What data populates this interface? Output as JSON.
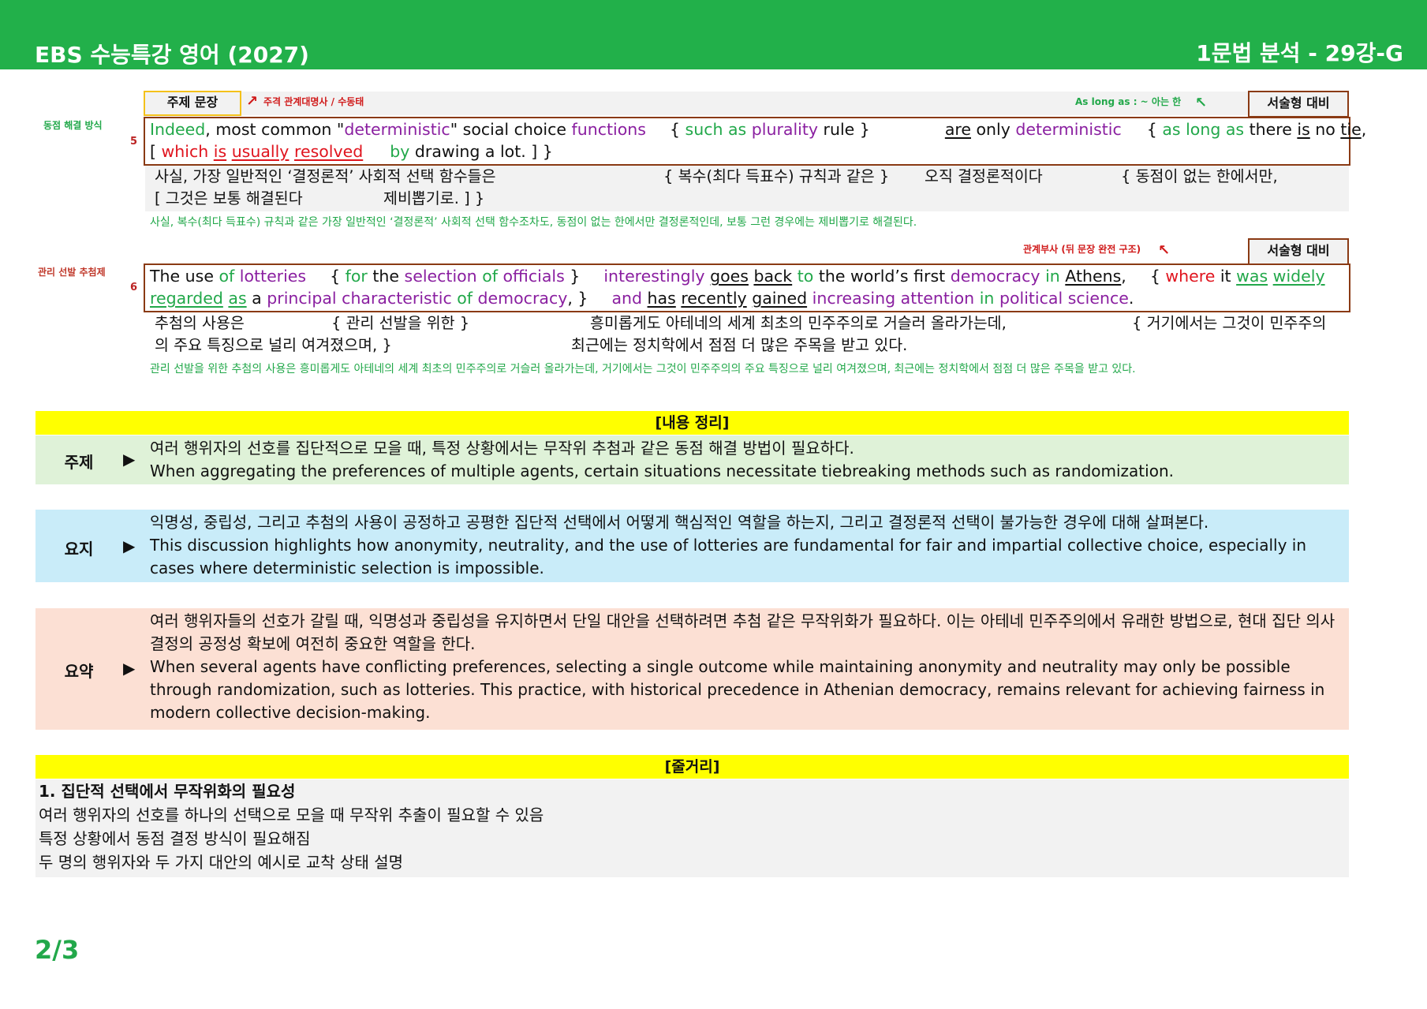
{
  "header": {
    "title_left": "EBS 수능특강 영어 (2027)",
    "title_right": "1문법 분석 - 29강-G"
  },
  "tags": {
    "topic_sentence": "주제 문장",
    "essay_prep": "서술형 대비",
    "note_relative": "주격 관계대명사 / 수동태",
    "note_aslongas": "As long as : ~ 아는 한",
    "note_reladverb": "관계부사 (뒤 문장 완전 구조)"
  },
  "s5": {
    "side": "동점 해결 방식",
    "num": "5",
    "en": {
      "p1": "Indeed",
      "p2": ", most common \"",
      "p3": "deterministic",
      "p4": "\" social choice ",
      "p5": "functions",
      "p6": "{ ",
      "p7": "such as",
      "p8": " ",
      "p9": "plurality",
      "p10": " rule }",
      "p11": "are",
      "p12": " only ",
      "p13": "deterministic",
      "p14": "{ ",
      "p15": "as long as",
      "p16": " there ",
      "p17": "is",
      "p18": " no ",
      "p19": "tie",
      "p20": ",",
      "p21": "[ ",
      "p22": "which",
      "p23": " ",
      "p24": "is",
      "p25": " ",
      "p26": "usually",
      "p27": " ",
      "p28": "resolved",
      "p29": "by",
      "p30": " drawing a lot. ] }"
    },
    "ko": {
      "a": "사실, 가장 일반적인 ‘결정론적’ 사회적 선택 함수들은",
      "b": "{ 복수(최다 득표수) 규칙과 같은 }",
      "c": "오직 결정론적이다",
      "d": "{ 동점이 없는 한에서만,",
      "e": "[ 그것은 보통 해결된다",
      "f": "제비뽑기로. ] }"
    },
    "free": "사실, 복수(최다 득표수) 규칙과 같은 가장 일반적인 ‘결정론적’ 사회적 선택 함수조차도, 동점이 없는 한에서만 결정론적인데, 보통 그런 경우에는 제비뽑기로 해결된다."
  },
  "s6": {
    "side": "관리 선발 추첨제",
    "num": "6",
    "en": {
      "p1": "The use ",
      "p2": "of",
      "p3": " ",
      "p4": "lotteries",
      "p5": "{ ",
      "p6": "for",
      "p7": " the ",
      "p8": "selection",
      "p9": " ",
      "p10": "of",
      "p11": " ",
      "p12": "officials",
      "p13": " }",
      "p14": "interestingly",
      "p15": " ",
      "p16": "goes",
      "p17": " ",
      "p18": "back",
      "p19": " ",
      "p20": "to",
      "p21": " the world’s first ",
      "p22": "democracy",
      "p23": " ",
      "p24": "in",
      "p25": " ",
      "p26": "Athens",
      "p27": ",",
      "p28": "{ ",
      "p29": "where",
      "p30": " it ",
      "p31": "was",
      "p32": " ",
      "p33": "widely",
      "p34": "regarded",
      "p35": " ",
      "p36": "as",
      "p37": " a ",
      "p38": "principal",
      "p39": " ",
      "p40": "characteristic",
      "p41": " ",
      "p42": "of",
      "p43": " ",
      "p44": "democracy",
      "p45": ", }",
      "p46": "and",
      "p47": " ",
      "p48": "has",
      "p49": " ",
      "p50": "recently",
      "p51": " ",
      "p52": "gained",
      "p53": " ",
      "p54": "increasing",
      "p55": " ",
      "p56": "attention",
      "p57": " ",
      "p58": "in",
      "p59": " ",
      "p60": "political",
      "p61": " ",
      "p62": "science",
      "p63": "."
    },
    "ko": {
      "a": "추첨의 사용은",
      "b": "{ 관리 선발을 위한 }",
      "c": "흥미롭게도 아테네의 세계 최초의 민주주의로 거슬러 올라가는데,",
      "d": "{ 거기에서는 그것이 민주주의",
      "e": "의 주요 특징으로 널리 여겨졌으며, }",
      "f": "최근에는 정치학에서 점점 더 많은 주목을 받고 있다."
    },
    "free": "관리 선발을 위한 추첨의 사용은 흥미롭게도 아테네의 세계 최초의 민주주의로 거슬러 올라가는데, 거기에서는 그것이 민주주의의 주요 특징으로 널리 여겨졌으며, 최근에는 정치학에서 점점 더 많은 주목을 받고 있다."
  },
  "summary": {
    "heading": "[내용 정리]",
    "arrow": "▶",
    "topic": {
      "label": "주제",
      "ko": "여러 행위자의 선호를 집단적으로 모을 때, 특정 상황에서는 무작위 추첨과 같은 동점 해결 방법이 필요하다.",
      "en": "When aggregating the preferences of multiple agents, certain situations necessitate tiebreaking methods such as randomization.",
      "bg": "#dff2d8"
    },
    "gist": {
      "label": "요지",
      "ko": "익명성, 중립성, 그리고 추첨의 사용이 공정하고 공평한 집단적 선택에서 어떻게 핵심적인 역할을 하는지, 그리고 결정론적 선택이 불가능한 경우에 대해 살펴본다.",
      "en": "This discussion highlights how anonymity, neutrality, and the use of lotteries are fundamental for fair and impartial collective choice, especially in cases where deterministic selection is impossible.",
      "bg": "#c9ecf9"
    },
    "abstract": {
      "label": "요약",
      "ko": "여러 행위자들의 선호가 갈릴 때, 익명성과 중립성을 유지하면서 단일 대안을 선택하려면 추첨 같은 무작위화가 필요하다. 이는 아테네 민주주의에서 유래한 방법으로, 현대 집단 의사결정의 공정성 확보에 여전히 중요한 역할을 한다.",
      "en": "When several agents have conflicting preferences, selecting a single outcome while maintaining anonymity and neutrality may only be possible through randomization, such as lotteries. This practice, with historical precedence in Athenian democracy, remains relevant for achieving fairness in modern collective decision-making.",
      "bg": "#fce0d4"
    }
  },
  "story": {
    "heading": "[줄거리]",
    "title": "1. 집단적 선택에서 무작위화의 필요성",
    "lines": [
      "여러 행위자의 선호를 하나의 선택으로 모을 때 무작위 추출이 필요할 수 있음",
      "특정 상황에서 동점 결정 방식이 필요해짐",
      "두 명의 행위자와 두 가지 대안의 예시로 교착 상태 설명"
    ]
  },
  "page": "2/3",
  "colors": {
    "brand_green": "#22b04a",
    "highlight_yellow": "#ffff00",
    "box_brown": "#8a3a14",
    "tag_yellow": "#f4c11a"
  }
}
